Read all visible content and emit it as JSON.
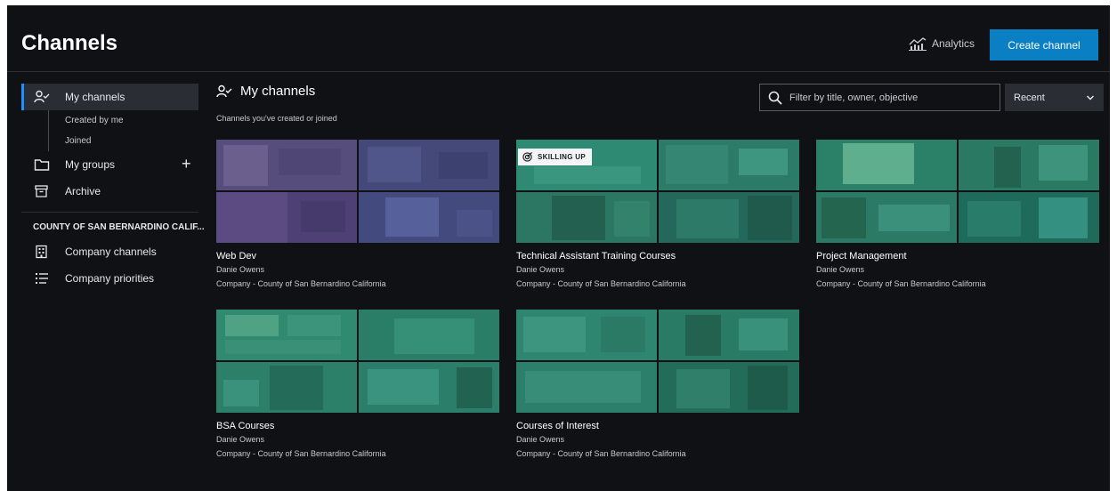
{
  "header": {
    "title": "Channels",
    "analytics_label": "Analytics",
    "analytics_icon": "bar-chart-icon",
    "create_label": "Create channel",
    "accent": "#0b7fc4"
  },
  "sidebar": {
    "my_channels": "My channels",
    "created_by_me": "Created by me",
    "joined": "Joined",
    "my_groups": "My groups",
    "archive": "Archive",
    "org_label": "COUNTY OF SAN BERNARDINO CALIF...",
    "company_channels": "Company channels",
    "company_priorities": "Company priorities"
  },
  "main": {
    "title": "My channels",
    "subtitle": "Channels you've created or joined",
    "filter_placeholder": "Filter by title, owner, objective",
    "sort_value": "Recent"
  },
  "cards": [
    {
      "title": "Web Dev",
      "owner": "Danie Owens",
      "company": "Company - County of San Bernardino California",
      "tint": "purple"
    },
    {
      "title": "Technical Assistant Training Courses",
      "owner": "Danie Owens",
      "company": "Company - County of San Bernardino California",
      "badge": "SKILLING UP",
      "tint": "green"
    },
    {
      "title": "Project Management",
      "owner": "Danie Owens",
      "company": "Company - County of San Bernardino California",
      "tint": "green"
    },
    {
      "title": "BSA Courses",
      "owner": "Danie Owens",
      "company": "Company - County of San Bernardino California",
      "tint": "green"
    },
    {
      "title": "Courses of Interest",
      "owner": "Danie Owens",
      "company": "Company - County of San Bernardino California",
      "tint": "green"
    }
  ]
}
